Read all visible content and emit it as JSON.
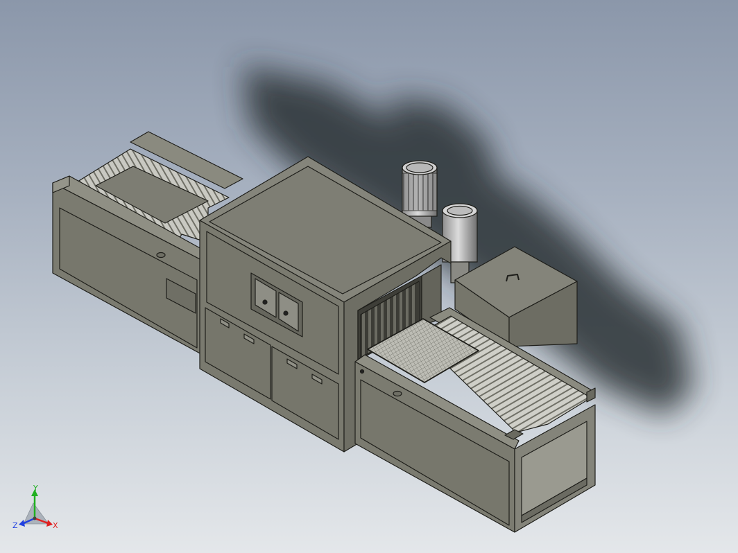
{
  "viewport": {
    "background_top": "#8b97aa",
    "background_bottom": "#e4e7ea",
    "model_color": "#7b7b70",
    "model_edge_color": "#1e1e1a",
    "shadow_color": "#2b3036"
  },
  "triad": {
    "x_label": "X",
    "y_label": "Y",
    "z_label": "Z",
    "x_color": "#e02020",
    "y_color": "#20b020",
    "z_color": "#2040e0"
  }
}
